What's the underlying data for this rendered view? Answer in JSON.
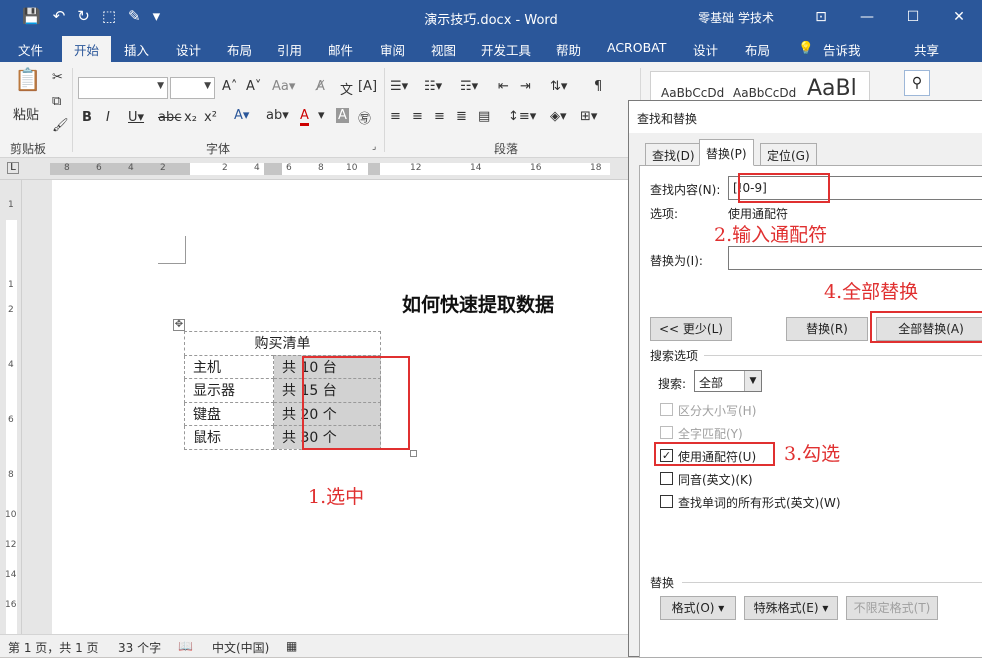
{
  "window": {
    "title": "演示技巧.docx - Word",
    "account": "零基础 学技术",
    "controls": {
      "minimize": "—",
      "restore": "☐",
      "close": "✕",
      "ribbon_options": "⊡"
    }
  },
  "qat": [
    "💾",
    "↶",
    "↻",
    "⬚",
    "✎",
    "▾"
  ],
  "tabs": [
    "文件",
    "开始",
    "插入",
    "设计",
    "布局",
    "引用",
    "邮件",
    "审阅",
    "视图",
    "开发工具",
    "帮助",
    "ACROBAT",
    "设计",
    "布局"
  ],
  "tell_me": "告诉我",
  "share": "共享",
  "ribbon": {
    "paste": "粘贴",
    "clipboard": "剪贴板",
    "font_group": "字体",
    "paragraph_group": "段落",
    "font_name": "",
    "font_size": "",
    "styles": [
      "AaBbCcDd",
      "AaBbCcDd",
      "AaBl"
    ]
  },
  "ruler": {
    "h_numbers": [
      "8",
      "6",
      "4",
      "2",
      "2",
      "4",
      "6",
      "8",
      "10",
      "12",
      "14",
      "16",
      "18"
    ],
    "v_numbers": [
      "1",
      "1",
      "2",
      "4",
      "6",
      "8",
      "10",
      "12",
      "14",
      "16"
    ]
  },
  "document": {
    "title": "如何快速提取数据",
    "table": {
      "header": "购买清单",
      "rows": [
        [
          "主机",
          "共 10 台"
        ],
        [
          "显示器",
          "共 15 台"
        ],
        [
          "键盘",
          "共 20 个"
        ],
        [
          "鼠标",
          "共 30 个"
        ]
      ]
    }
  },
  "annotations": {
    "step1": "1.选中",
    "step2": "2.输入通配符",
    "step3": "3.勾选",
    "step4": "4.全部替换"
  },
  "dialog": {
    "title": "查找和替换",
    "tabs": [
      "查找(D)",
      "替换(P)",
      "定位(G)"
    ],
    "find_label": "查找内容(N):",
    "find_value": "[!0-9]",
    "options_label": "选项:",
    "options_value": "使用通配符",
    "replace_label": "替换为(I):",
    "replace_value": "",
    "less_button": "<< 更少(L)",
    "replace_button": "替换(R)",
    "replace_all_button": "全部替换(A)",
    "search_options_label": "搜索选项",
    "search_label": "搜索:",
    "search_value": "全部",
    "checks": {
      "match_case": "区分大小写(H)",
      "whole_word": "全字匹配(Y)",
      "wildcards": "使用通配符(U)",
      "sounds_like": "同音(英文)(K)",
      "word_forms": "查找单词的所有形式(英文)(W)"
    },
    "replace_section": "替换",
    "format_button": "格式(O)",
    "special_button": "特殊格式(E)",
    "no_format_button": "不限定格式(T)"
  },
  "statusbar": {
    "page": "第 1 页，共 1 页",
    "words": "33 个字",
    "language": "中文(中国)"
  }
}
